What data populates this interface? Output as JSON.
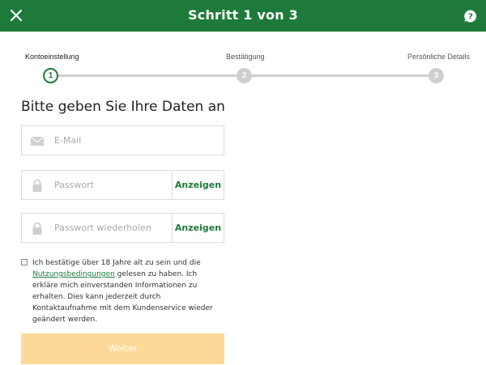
{
  "header": {
    "title": "Schritt 1 von 3",
    "close_icon": "close-icon",
    "help_icon": "help-chat-icon",
    "background_color": "#1e7a3a"
  },
  "stepper": {
    "steps": [
      {
        "label": "Kontoeinstellung",
        "number": "1",
        "state": "active"
      },
      {
        "label": "Bestätigung",
        "number": "2",
        "state": "inactive"
      },
      {
        "label": "Persönliche Details",
        "number": "3",
        "state": "inactive"
      }
    ],
    "active_color": "#1e7a3a",
    "inactive_color": "#cfcfcf"
  },
  "form": {
    "heading": "Bitte geben Sie Ihre Daten an",
    "email": {
      "placeholder": "E-Mail",
      "icon": "envelope-icon",
      "value": ""
    },
    "password": {
      "placeholder": "Passwort",
      "icon": "lock-icon",
      "show_label": "Anzeigen",
      "value": ""
    },
    "password_repeat": {
      "placeholder": "Passwort wiederholen",
      "icon": "lock-icon",
      "show_label": "Anzeigen",
      "value": ""
    },
    "terms": {
      "checked": false,
      "text_before": "Ich bestätige über 18 Jahre alt zu sein und die ",
      "link_text": "Nutzungsbedingungen",
      "text_after": " gelesen zu haben. Ich erkläre mich einverstanden Informationen zu erhalten. Dies kann jederzeit durch Kontaktaufnahme mit dem Kundenservice wieder geändert werden."
    },
    "submit_label": "Weiter",
    "submit_color": "#fdd997"
  }
}
